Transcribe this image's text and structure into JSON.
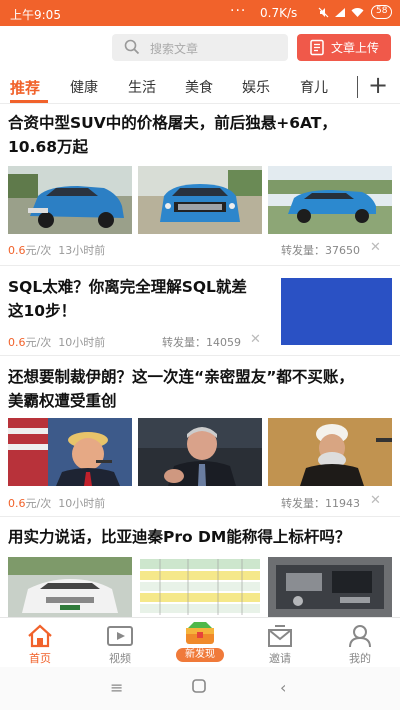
{
  "status": {
    "time": "上午9:05",
    "dots": "···",
    "speed": "0.7K/s",
    "battery": "58"
  },
  "search": {
    "placeholder": "搜索文章"
  },
  "upload": {
    "label": "文章上传"
  },
  "tabs": [
    "推荐",
    "健康",
    "生活",
    "美食",
    "娱乐",
    "育儿"
  ],
  "articles": [
    {
      "title_line1": "合资中型SUV中的价格屠夫，前后独悬+6AT，",
      "title_line2": "10.68万起",
      "price": "0.6",
      "unit": "元/次",
      "time": "13小时前",
      "share_label": "转发量：",
      "share_count": "37650"
    },
    {
      "title_line1": "SQL太难？你离完全理解SQL就差",
      "title_line2": "这10步！",
      "price": "0.6",
      "unit": "元/次",
      "time": "10小时前",
      "share_label": "转发量：",
      "share_count": "14059"
    },
    {
      "title_line1": "还想要制裁伊朗？这一次连“亲密盟友”都不买账，",
      "title_line2": "美霸权遭受重创",
      "price": "0.6",
      "unit": "元/次",
      "time": "10小时前",
      "share_label": "转发量：",
      "share_count": "11943"
    },
    {
      "title_line1": "用实力说话，比亚迪秦Pro DM能称得上标杆吗？"
    }
  ],
  "nav": {
    "home": "首页",
    "video": "视频",
    "discover": "新发现",
    "invite": "邀请",
    "me": "我的"
  },
  "colors": {
    "accent": "#f1622b",
    "upload_bg": "#f0594a",
    "sql_block": "#2a51c4"
  }
}
